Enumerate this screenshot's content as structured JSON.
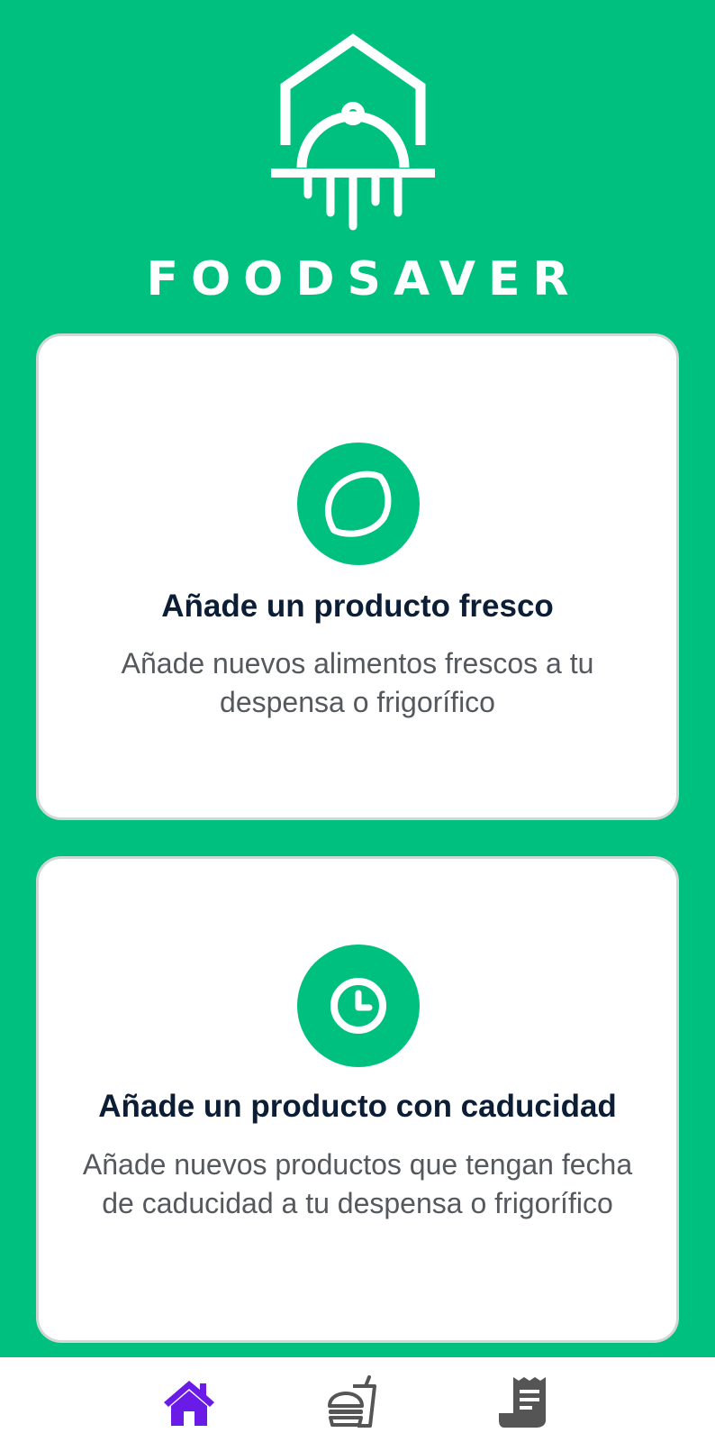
{
  "brand": {
    "name": "FOODSAVER",
    "logo_icon": "house-cloche-logo"
  },
  "cards": [
    {
      "icon": "lemon-icon",
      "title": "Añade un producto fresco",
      "description": "Añade nuevos alimentos frescos a tu despensa o frigorífico"
    },
    {
      "icon": "clock-icon",
      "title": "Añade un producto con caducidad",
      "description": "Añade nuevos productos que tengan fecha de caducidad a tu despensa o frigorífico"
    }
  ],
  "bottom_nav": {
    "items": [
      {
        "icon": "home-icon",
        "active": true
      },
      {
        "icon": "fast-food-icon",
        "active": false
      },
      {
        "icon": "receipt-icon",
        "active": false
      }
    ]
  },
  "colors": {
    "brand_green": "#00C07F",
    "active_nav": "#6A1BE8",
    "inactive_nav": "#555555",
    "title_text": "#0C1E36",
    "body_text": "#55595E"
  }
}
